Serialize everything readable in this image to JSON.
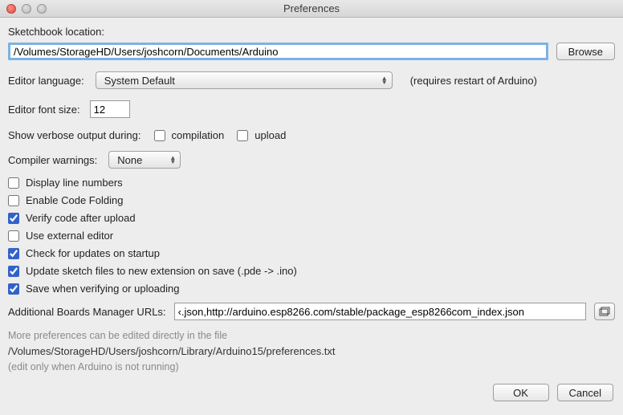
{
  "window": {
    "title": "Preferences"
  },
  "sketchbook": {
    "label": "Sketchbook location:",
    "value": "/Volumes/StorageHD/Users/joshcorn/Documents/Arduino",
    "browse": "Browse"
  },
  "language": {
    "label": "Editor language:",
    "value": "System Default",
    "note": "(requires restart of Arduino)"
  },
  "font": {
    "label": "Editor font size:",
    "value": "12"
  },
  "verbose": {
    "label": "Show verbose output during:",
    "compilation": "compilation",
    "upload": "upload"
  },
  "warnings": {
    "label": "Compiler warnings:",
    "value": "None"
  },
  "options": [
    {
      "label": "Display line numbers",
      "checked": false
    },
    {
      "label": "Enable Code Folding",
      "checked": false
    },
    {
      "label": "Verify code after upload",
      "checked": true
    },
    {
      "label": "Use external editor",
      "checked": false
    },
    {
      "label": "Check for updates on startup",
      "checked": true
    },
    {
      "label": "Update sketch files to new extension on save (.pde -> .ino)",
      "checked": true
    },
    {
      "label": "Save when verifying or uploading",
      "checked": true
    }
  ],
  "boards": {
    "label": "Additional Boards Manager URLs:",
    "value": "‹.json,http://arduino.esp8266.com/stable/package_esp8266com_index.json"
  },
  "more": {
    "line1": "More preferences can be edited directly in the file",
    "path": "/Volumes/StorageHD/Users/joshcorn/Library/Arduino15/preferences.txt",
    "line3": "(edit only when Arduino is not running)"
  },
  "buttons": {
    "ok": "OK",
    "cancel": "Cancel"
  }
}
